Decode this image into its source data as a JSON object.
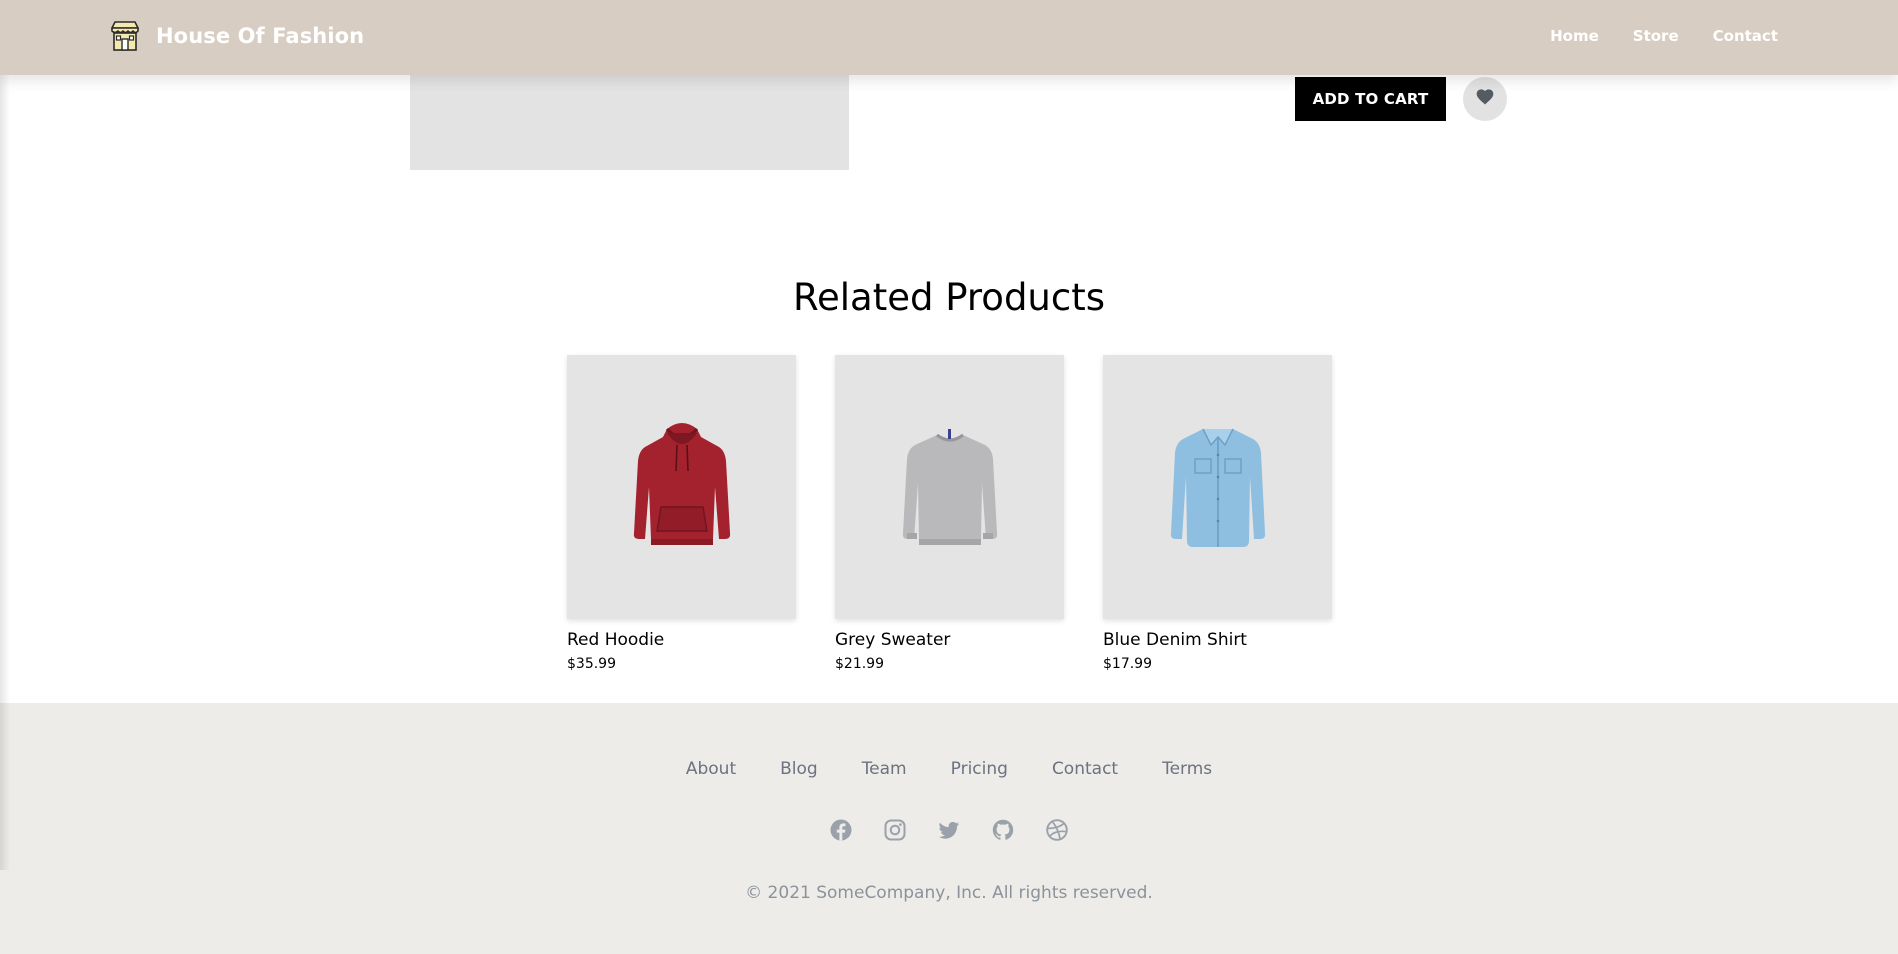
{
  "header": {
    "brand_title": "House Of Fashion",
    "brand_icon": "store-icon",
    "nav": [
      {
        "label": "Home"
      },
      {
        "label": "Store"
      },
      {
        "label": "Contact"
      }
    ]
  },
  "product_actions": {
    "add_to_cart_label": "ADD TO CART",
    "wishlist_icon": "heart-icon"
  },
  "related": {
    "title": "Related Products",
    "products": [
      {
        "name": "Red Hoodie",
        "price": "$35.99",
        "color": "#a3222e",
        "icon": "hoodie-icon"
      },
      {
        "name": "Grey Sweater",
        "price": "$21.99",
        "color": "#b9b9bb",
        "icon": "sweater-icon"
      },
      {
        "name": "Blue Denim Shirt",
        "price": "$17.99",
        "color": "#8fbfe0",
        "icon": "shirt-icon"
      }
    ]
  },
  "footer": {
    "links": [
      {
        "label": "About"
      },
      {
        "label": "Blog"
      },
      {
        "label": "Team"
      },
      {
        "label": "Pricing"
      },
      {
        "label": "Contact"
      },
      {
        "label": "Terms"
      }
    ],
    "socials": [
      "facebook-icon",
      "instagram-icon",
      "twitter-icon",
      "github-icon",
      "dribbble-icon"
    ],
    "copyright": "© 2021 SomeCompany, Inc. All rights reserved."
  },
  "colors": {
    "header_bg": "#d8cdc2",
    "footer_bg": "#edece8",
    "footer_text": "#6b7280",
    "card_bg": "#e4e4e4"
  }
}
